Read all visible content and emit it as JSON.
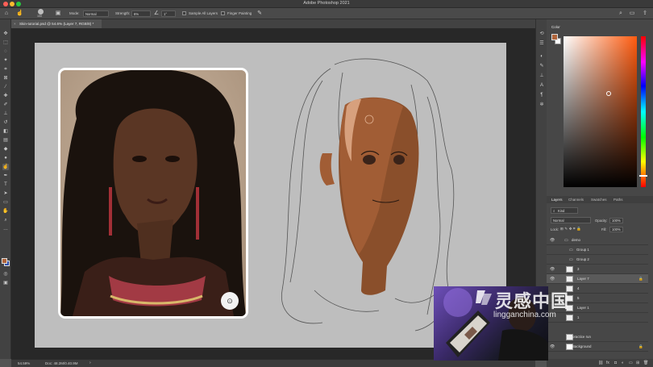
{
  "window": {
    "title": "Adobe Photoshop 2021"
  },
  "options_bar": {
    "brush_size": "100",
    "mode_label": "Mode:",
    "mode_value": "Normal",
    "strength_label": "Strength:",
    "strength_value": "6%",
    "angle_value": "1°",
    "sample_all_layers": "Sample All Layers",
    "finger_painting": "Finger Painting"
  },
  "document": {
    "tab_label": "Skin-tutorial.psd @ 54.6% (Layer 7, RGB/8) *",
    "zoom": "54.59%",
    "doc_size": "Doc: 48.2M/0.40.9M"
  },
  "color_panel": {
    "tab_label": "Color",
    "foreground_color": "#b0643a",
    "background_color": "#ffffff"
  },
  "layers_panel": {
    "tabs": [
      "Layers",
      "Channels",
      "Swatches",
      "Paths"
    ],
    "filter_label": "Kind",
    "blend_mode": "Normal",
    "opacity_label": "Opacity:",
    "opacity_value": "100%",
    "lock_label": "Lock:",
    "fill_label": "Fill:",
    "fill_value": "100%",
    "layers": [
      {
        "name": "demo",
        "type": "group"
      },
      {
        "name": "Group 1",
        "type": "group"
      },
      {
        "name": "Group 2",
        "type": "group"
      },
      {
        "name": "3",
        "type": "layer"
      },
      {
        "name": "Layer 7",
        "type": "layer",
        "selected": true
      },
      {
        "name": "4",
        "type": "layer"
      },
      {
        "name": "5",
        "type": "layer"
      },
      {
        "name": "Layer 1",
        "type": "layer"
      },
      {
        "name": "1",
        "type": "layer"
      },
      {
        "name": "practice run",
        "type": "layer"
      },
      {
        "name": "Background",
        "type": "layer"
      }
    ]
  },
  "watermark": {
    "brand_cn": "灵感中国",
    "brand_url": "lingganchina.com"
  }
}
